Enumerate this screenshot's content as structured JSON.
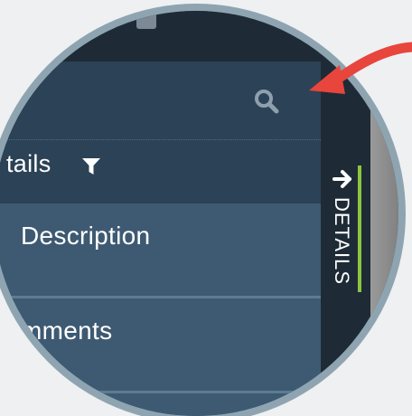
{
  "search": {
    "icon": "search-icon"
  },
  "filter": {
    "label": "tails",
    "icon": "filter-icon"
  },
  "list": {
    "items": [
      {
        "label": "Description"
      },
      {
        "label": "mments"
      }
    ]
  },
  "details_tab": {
    "label": "DETAILS",
    "icon": "arrow-right-icon",
    "accent_color": "#8cc63f"
  },
  "annotation": {
    "icon": "red-pointer-arrow",
    "color": "#e8453c"
  },
  "colors": {
    "topbar": "#1e2b36",
    "panel_dark": "#2c4256",
    "panel": "#3e5a72",
    "ring": "#8fa4b1"
  }
}
